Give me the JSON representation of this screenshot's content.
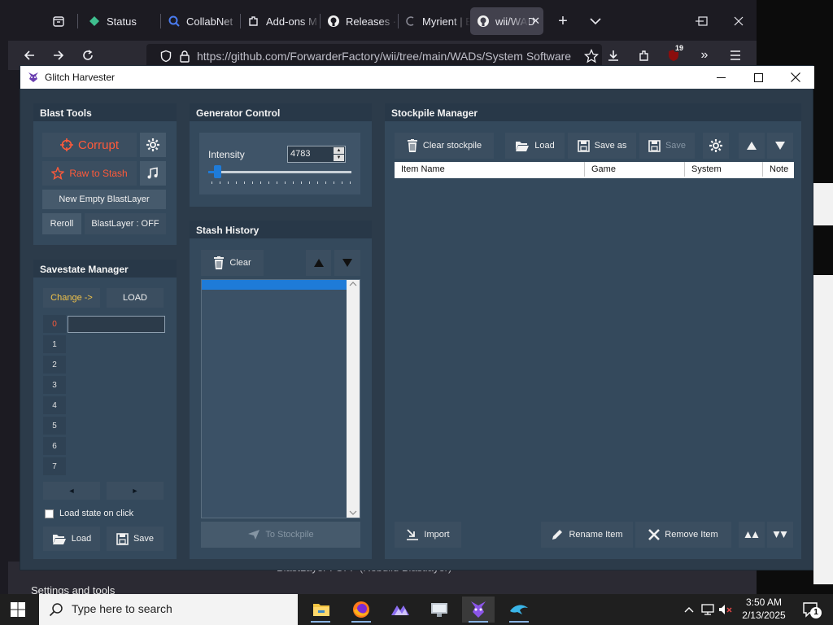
{
  "browser": {
    "tabs": [
      {
        "label": "",
        "icon": "tab-overview-icon"
      },
      {
        "label": "Status",
        "icon": "status-icon"
      },
      {
        "label": "CollabNet",
        "icon": "search-icon"
      },
      {
        "label": "Add-ons M",
        "icon": "puzzle-icon"
      },
      {
        "label": "Releases ·",
        "icon": "github-icon"
      },
      {
        "label": "Myrient | E",
        "icon": "myrient-icon"
      },
      {
        "label": "wii/WAD",
        "icon": "github-icon",
        "active": true
      }
    ],
    "url": "https://github.com/ForwarderFactory/wii/tree/main/WADs/System Software",
    "badge_count": "19",
    "settings_tools": "Settings and tools",
    "status_line": "BlastLayer : OFF  (Rebuild Blastlayer)"
  },
  "app": {
    "title": "Glitch Harvester",
    "blast_tools": {
      "heading": "Blast Tools",
      "corrupt": "Corrupt",
      "raw_to_stash": "Raw to Stash",
      "new_empty_blastlayer": "New Empty BlastLayer",
      "reroll": "Reroll",
      "blastlayer_status": "BlastLayer : OFF"
    },
    "generator": {
      "heading": "Generator Control",
      "intensity_label": "Intensity",
      "intensity_value": "4783",
      "slider_level": 0.04
    },
    "savestate": {
      "heading": "Savestate Manager",
      "change": "Change ->",
      "load": "LOAD",
      "slots": [
        "0",
        "1",
        "2",
        "3",
        "4",
        "5",
        "6",
        "7"
      ],
      "prev": "◄",
      "next": "►",
      "load_on_click": "Load state on click",
      "load_button": "Load",
      "save_button": "Save"
    },
    "stash": {
      "heading": "Stash History",
      "clear": "Clear",
      "selected_item": "",
      "to_stockpile": "To Stockpile"
    },
    "stockpile": {
      "heading": "Stockpile Manager",
      "clear_stockpile": "Clear stockpile",
      "load": "Load",
      "save_as": "Save as",
      "save": "Save",
      "columns": [
        "Item Name",
        "Game",
        "System",
        "Note"
      ],
      "import": "Import",
      "rename_item": "Rename Item",
      "remove_item": "Remove Item"
    }
  },
  "taskbar": {
    "search_placeholder": "Type here to search",
    "time": "3:50 AM",
    "date": "2/13/2025",
    "notification_count": "1"
  }
}
